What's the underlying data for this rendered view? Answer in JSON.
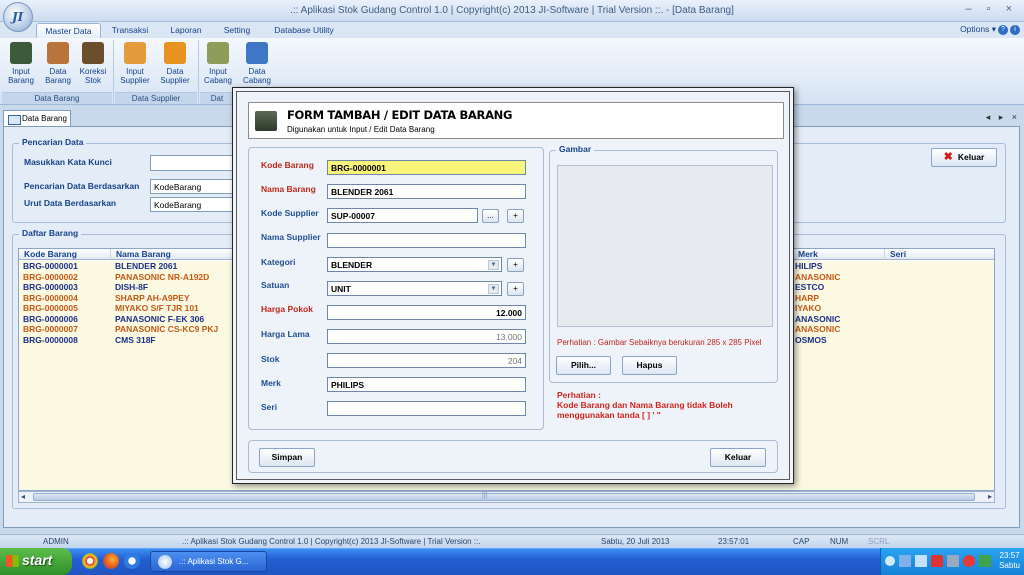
{
  "window": {
    "title": ".:: Aplikasi Stok Gudang Control 1.0   |  Copyright(c) 2013 JI-Software   |   Trial Version  ::.   - [Data Barang]",
    "orb_label": "JI",
    "controls": "– ▫ ×"
  },
  "ribbon": {
    "tabs": [
      "Master Data",
      "Transaksi",
      "Laporan",
      "Setting",
      "Database Utility"
    ],
    "options_label": "Options",
    "buttons": [
      {
        "label": "Input Barang",
        "icon": "input-barang-icon",
        "color": "#3d5b3a"
      },
      {
        "label": "Data Barang",
        "icon": "data-barang-icon",
        "color": "#b8743a"
      },
      {
        "label": "Koreksi Stok",
        "icon": "koreksi-stok-icon",
        "color": "#6b4e2c"
      },
      {
        "label": "Input Supplier",
        "icon": "input-supplier-icon",
        "color": "#e39b3c"
      },
      {
        "label": "Data Supplier",
        "icon": "data-supplier-icon",
        "color": "#e8931f"
      },
      {
        "label": "Input Cabang",
        "icon": "input-cabang-icon",
        "color": "#8f9c5a"
      },
      {
        "label": "Data Cabang",
        "icon": "data-cabang-icon",
        "color": "#3f77c7"
      }
    ],
    "groups": [
      "Data Barang",
      "Data Supplier",
      "Dat"
    ]
  },
  "doc_tab": {
    "label": "Data Barang",
    "controls": "◂ ▸ ×"
  },
  "search": {
    "group_title": "Pencarian Data",
    "keyword_label": "Masukkan Kata Kunci",
    "keyword_value": "",
    "by_label": "Pencarian Data Berdasarkan",
    "by_value": "KodeBarang",
    "sort_label": "Urut Data Berdasarkan",
    "sort_value": "KodeBarang"
  },
  "keluar_main": "Keluar",
  "list": {
    "group_title": "Daftar Barang",
    "columns": [
      "Kode Barang",
      "Nama Barang",
      "Merk",
      "Seri"
    ],
    "rows": [
      {
        "kode": "BRG-0000001",
        "nama": "BLENDER 2061",
        "merk": "HILIPS",
        "color": "#1c2f8a"
      },
      {
        "kode": "BRG-0000002",
        "nama": "PANASONIC NR-A192D",
        "merk": "ANASONIC",
        "color": "#c25a16"
      },
      {
        "kode": "BRG-0000003",
        "nama": "DISH-8F",
        "merk": "ESTCO",
        "color": "#1c2f8a"
      },
      {
        "kode": "BRG-0000004",
        "nama": "SHARP AH-A9PEY",
        "merk": "HARP",
        "color": "#c25a16"
      },
      {
        "kode": "BRG-0000005",
        "nama": "MIYAKO S/F TJR 101",
        "merk": "IYAKO",
        "color": "#c25a16"
      },
      {
        "kode": "BRG-0000006",
        "nama": "PANASONIC F-EK 306",
        "merk": "ANASONIC",
        "color": "#1c2f8a"
      },
      {
        "kode": "BRG-0000007",
        "nama": "PANASONIC CS-KC9 PKJ",
        "merk": "ANASONIC",
        "color": "#c25a16"
      },
      {
        "kode": "BRG-0000008",
        "nama": "CMS 318F",
        "merk": "OSMOS",
        "color": "#1c2f8a"
      }
    ],
    "scroll_grip": "|||"
  },
  "dialog": {
    "title": "FORM TAMBAH / EDIT DATA BARANG",
    "subtitle": "Digunakan untuk Input / Edit Data Barang",
    "fields": {
      "kode_barang": {
        "label": "Kode Barang",
        "value": "BRG-0000001"
      },
      "nama_barang": {
        "label": "Nama Barang",
        "value": "BLENDER 2061"
      },
      "kode_supplier": {
        "label": "Kode Supplier",
        "value": "SUP-00007"
      },
      "nama_supplier": {
        "label": "Nama Supplier",
        "value": ""
      },
      "kategori": {
        "label": "Kategori",
        "value": "BLENDER"
      },
      "satuan": {
        "label": "Satuan",
        "value": "UNIT"
      },
      "harga_pokok": {
        "label": "Harga Pokok",
        "value": "12.000"
      },
      "harga_lama": {
        "label": "Harga Lama",
        "value": "13.000"
      },
      "stok": {
        "label": "Stok",
        "value": "204"
      },
      "merk": {
        "label": "Merk",
        "value": "PHILIPS"
      },
      "seri": {
        "label": "Seri",
        "value": ""
      }
    },
    "browse_label": "...",
    "plus_label": "+",
    "gambar": {
      "title": "Gambar",
      "note": "Perhatian : Gambar Sebaiknya berukuran  285 x 285 Pixel",
      "pilih": "Pilih...",
      "hapus": "Hapus"
    },
    "warning": {
      "title": "Perhatian  :",
      "text1": "Kode Barang dan Nama Barang tidak Boleh",
      "text2": "menggunakan tanda [ ] ' \""
    },
    "simpan": "Simpan",
    "keluar": "Keluar"
  },
  "status": {
    "user": "ADMIN",
    "app": ".:: Aplikasi Stok Gudang Control 1.0  |  Copyright(c) 2013 JI-Software  |  Trial Version ::.",
    "date": "Sabtu, 20 Juli 2013",
    "time": "23:57:01",
    "cap": "CAP",
    "num": "NUM",
    "scrl": "SCRL"
  },
  "taskbar": {
    "start": "start",
    "task": ".:: Aplikasi Stok G...",
    "clock_time": "23:57",
    "clock_day": "Sabtu"
  }
}
